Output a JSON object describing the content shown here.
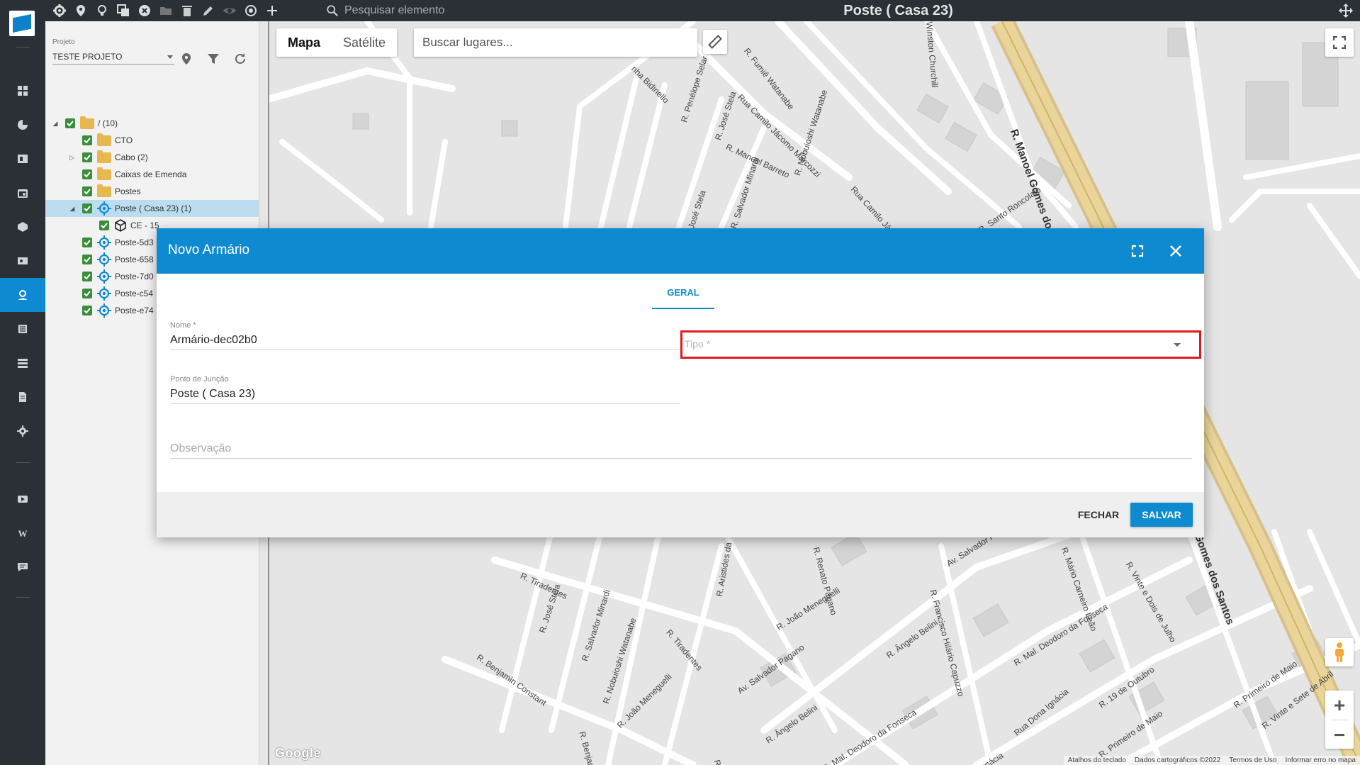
{
  "topbar": {
    "search_placeholder": "Pesquisar elemento",
    "title": "Poste ( Casa 23)",
    "icons": [
      "gear-icon",
      "map-pin-icon",
      "lightbulb-icon",
      "copy-icon",
      "cancel-circle-icon",
      "folder-icon",
      "trash-icon",
      "pencil-icon",
      "eye-icon",
      "target-icon",
      "plus-icon"
    ]
  },
  "sidebar": {
    "items": [
      {
        "icon": "grid-icon"
      },
      {
        "icon": "pie-chart-icon"
      },
      {
        "icon": "board-icon"
      },
      {
        "icon": "calendar-icon"
      },
      {
        "icon": "box-icon"
      },
      {
        "icon": "id-card-icon"
      },
      {
        "icon": "map-person-icon",
        "active": true
      },
      {
        "icon": "list-icon"
      },
      {
        "icon": "server-icon"
      },
      {
        "icon": "document-icon"
      },
      {
        "icon": "gear-icon"
      },
      {
        "icon": "video-icon"
      },
      {
        "icon": "wiki-icon"
      },
      {
        "icon": "chat-icon"
      }
    ]
  },
  "project": {
    "label": "Projeto",
    "selected": "TESTE PROJETO"
  },
  "tree": {
    "items": [
      {
        "label": "/ (10)",
        "level": 0,
        "expander": "open",
        "kind": "folder"
      },
      {
        "label": "CTO",
        "level": 1,
        "expander": "",
        "kind": "folder"
      },
      {
        "label": "Cabo (2)",
        "level": 1,
        "expander": "closed",
        "kind": "folder"
      },
      {
        "label": "Caixas de Emenda",
        "level": 1,
        "expander": "",
        "kind": "folder"
      },
      {
        "label": "Postes",
        "level": 1,
        "expander": "",
        "kind": "folder"
      },
      {
        "label": "Poste ( Casa 23) (1)",
        "level": 1,
        "expander": "open",
        "kind": "target",
        "selected": true
      },
      {
        "label": "CE - 15",
        "level": 2,
        "expander": "",
        "kind": "cube"
      },
      {
        "label": "Poste-5d3",
        "level": 1,
        "expander": "",
        "kind": "target"
      },
      {
        "label": "Poste-658",
        "level": 1,
        "expander": "",
        "kind": "target"
      },
      {
        "label": "Poste-7d0",
        "level": 1,
        "expander": "",
        "kind": "target"
      },
      {
        "label": "Poste-c54",
        "level": 1,
        "expander": "",
        "kind": "target"
      },
      {
        "label": "Poste-e74",
        "level": 1,
        "expander": "",
        "kind": "target"
      }
    ]
  },
  "map": {
    "type_buttons": [
      "Mapa",
      "Satélite"
    ],
    "search_placeholder": "Buscar lugares...",
    "google_logo": "Google",
    "attribution": [
      "Atalhos do teclado",
      "Dados cartográficos ©2022",
      "Termos de Uso",
      "Informar erro no mapa"
    ],
    "streets": [
      "nha Bidinello",
      "R. Penélope Selar",
      "R. Fumiê Watanabe",
      "R. José Stela",
      "Rua Camilo Jácomo Marcozzi",
      "R. Manoel Barreto",
      "R. Nobuioshi Watanabe",
      "R. Salvador Minardi",
      "José Stela",
      "Rua Camilo Jáco",
      "Winston Churchill",
      "R. Manoel Gomes dos Santos",
      "R. Santo Roncolato",
      "R. Tiradentes",
      "R. José Stela",
      "R. Salvador Minardi",
      "R. Nobuioshi Watanabe",
      "R. Benjamin Constant",
      "R. Tiradentes",
      "R. João Meneguelli",
      "R. Benjamin Co",
      "R. Aristides da",
      "R. Renato Pagano",
      "R. João Meneguelli",
      "Av. Salvador Pagano",
      "R. Ângelo Belini",
      "R. Mal. Deodoro da Fonseca",
      "R. Francisco Hilário Capuzzo",
      "R. Ângelo Belini",
      "Av. Salvador Pa",
      "R. Mário Carneiro Leão",
      "R. Mal. Deodoro da Fonseca",
      "Rua Dona Ignácia",
      "R. Vinte e Dois de Julho",
      "R. 19 de Outubro",
      "R. Primeiro de Maio",
      "R. Primeiro de Maio",
      "R. Vinte e Sete de Abril",
      "Gomes dos Santos",
      "R. Cesar",
      "Ignácia"
    ]
  },
  "modal": {
    "title": "Novo Armário",
    "tab": "GERAL",
    "nome_label": "Nome *",
    "nome_value": "Armário-dec02b0",
    "tipo_placeholder": "Tipo *",
    "juncao_label": "Ponto de Junção",
    "juncao_value": "Poste ( Casa 23)",
    "obs_placeholder": "Observação",
    "btn_fechar": "FECHAR",
    "btn_salvar": "SALVAR"
  },
  "colors": {
    "accent": "#0e8ad1",
    "highlight": "#e0191e",
    "nav_bg": "#2b3036",
    "check": "#3a8d3a",
    "folder": "#e6b84f"
  }
}
